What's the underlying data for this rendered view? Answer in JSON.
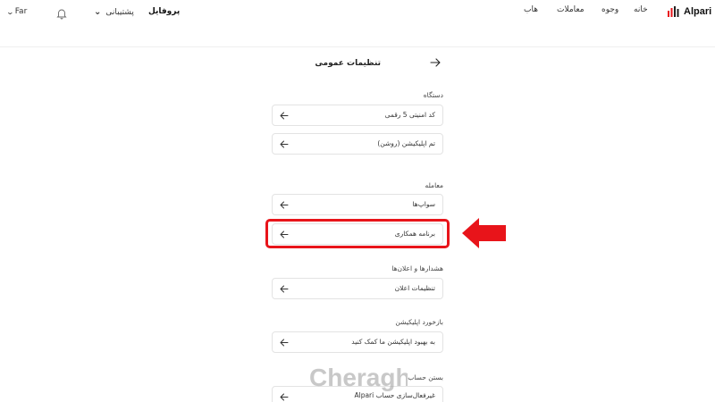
{
  "header": {
    "language": "Far",
    "support_label": "پشتیبانی",
    "profile_label": "پروفایل",
    "nav": [
      "خانه",
      "وجوه",
      "معاملات",
      "هاب"
    ],
    "logo_text": "Alpari"
  },
  "page": {
    "title": "تنظیمات عمومی"
  },
  "sections": [
    {
      "title": "دستگاه",
      "items": [
        "کد امنیتی 5 رقمی",
        "تم اپلیکیشن (روشن)"
      ]
    },
    {
      "title": "معامله",
      "items": [
        "سواپ‌ها",
        "برنامه همکاری"
      ]
    },
    {
      "title": "هشدارها و اعلان‌ها",
      "items": [
        "تنظیمات اعلان"
      ]
    },
    {
      "title": "بازخورد اپلیکیشن",
      "items": [
        "به بهبود اپلیکیشن ما کمک کنید"
      ]
    },
    {
      "title": "بستن حساب",
      "items": [
        "غیرفعال‌سازی حساب Alpari"
      ]
    }
  ],
  "watermark": {
    "text": "Cheragh"
  },
  "colors": {
    "highlight": "#e8141a",
    "logo_red": "#e8141a"
  },
  "icons": {
    "back": "arrow-right-icon",
    "row": "arrow-left-icon",
    "bell": "bell-icon",
    "chevron": "chevron-down-icon"
  }
}
